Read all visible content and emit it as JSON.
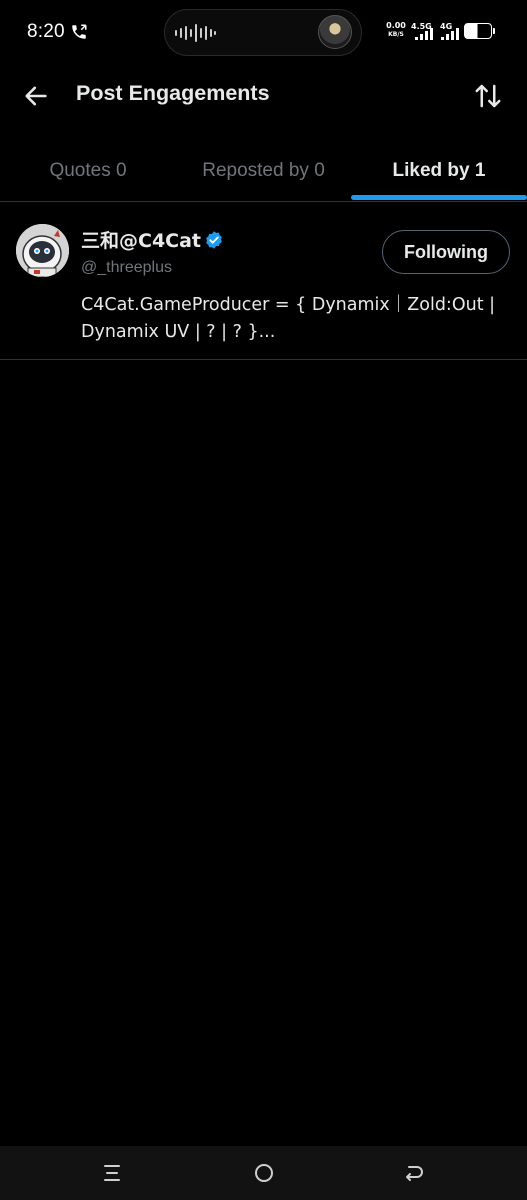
{
  "status_bar": {
    "time": "8:20",
    "net_speed_value": "0.00",
    "net_speed_unit": "KB/S",
    "network_1": "4.5G",
    "network_2": "4G",
    "battery": "48",
    "icons": [
      "call-icon",
      "voice-wave-icon",
      "signal-icon",
      "battery-icon"
    ]
  },
  "header": {
    "title": "Post Engagements",
    "back_icon": "arrow-left-icon",
    "sort_icon": "sort-arrows-icon"
  },
  "tabs": [
    {
      "label": "Quotes 0",
      "active": false
    },
    {
      "label": "Reposted by 0",
      "active": false
    },
    {
      "label": "Liked by 1",
      "active": true
    }
  ],
  "users": [
    {
      "display_name": "三和@C4Cat",
      "handle": "@_threeplus",
      "verified": true,
      "follow_label": "Following",
      "bio": "C4Cat.GameProducer = { Dynamix｜Zold:Out | Dynamix UV | ? | ? }..."
    }
  ],
  "nav_bar": {
    "icons": [
      "recents-icon",
      "home-icon",
      "back-icon"
    ]
  },
  "colors": {
    "accent": "#1d9bf0",
    "background": "#000000",
    "text_primary": "#e7e9ea",
    "text_secondary": "#71767b",
    "divider": "#2f3336"
  }
}
